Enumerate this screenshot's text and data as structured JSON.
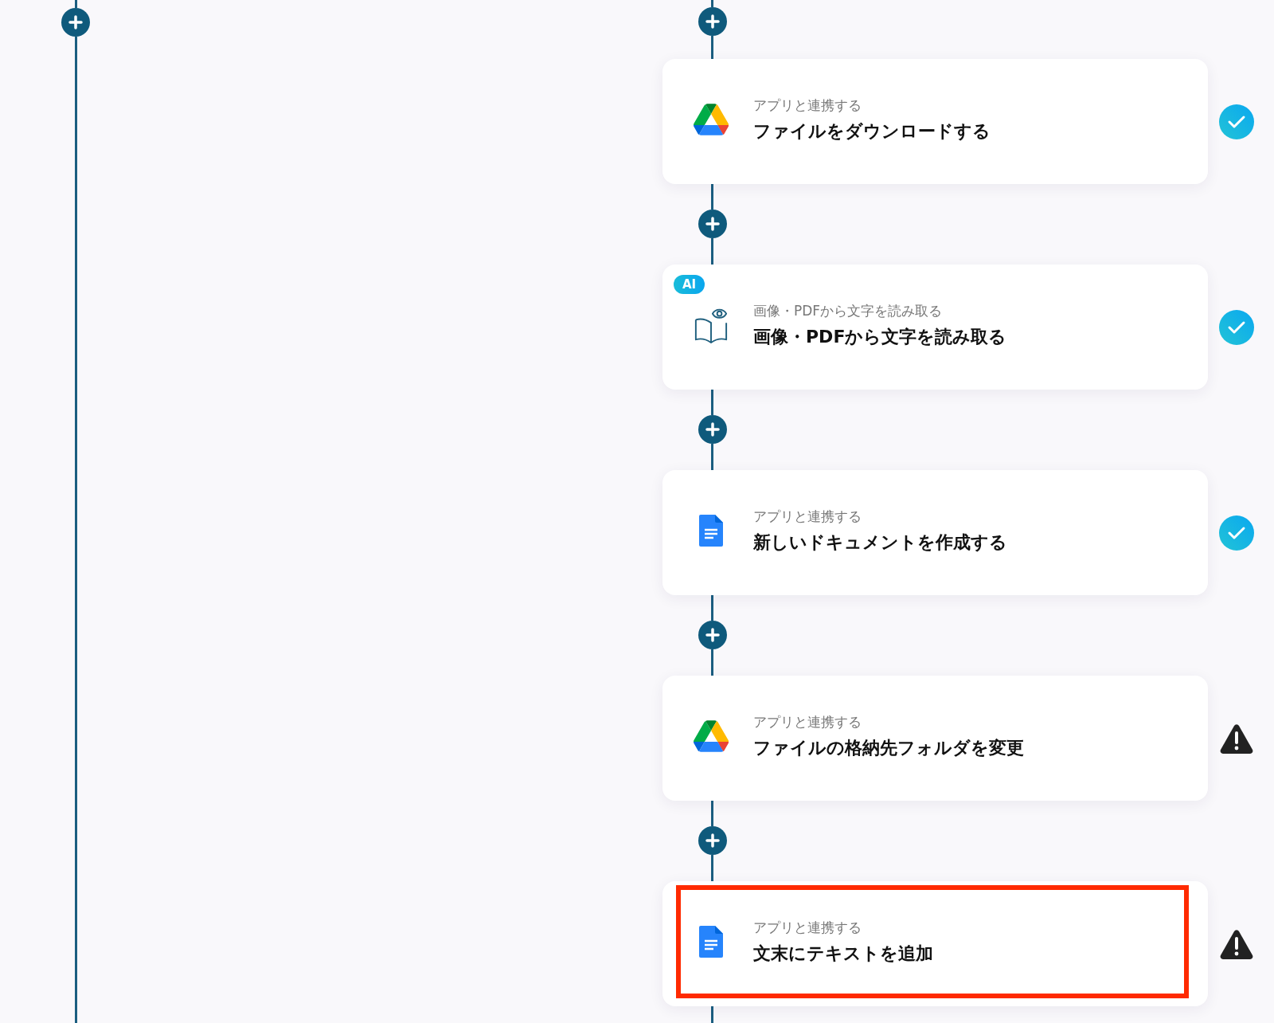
{
  "steps": [
    {
      "kind": "drive",
      "subtitle": "アプリと連携する",
      "title": "ファイルをダウンロードする",
      "completed": true,
      "highlighted": false
    },
    {
      "kind": "ocr",
      "ai_badge": "AI",
      "subtitle": "画像・PDFから文字を読み取る",
      "title": "画像・PDFから文字を読み取る",
      "completed": true,
      "highlighted": false
    },
    {
      "kind": "docs",
      "subtitle": "アプリと連携する",
      "title": "新しいドキュメントを作成する",
      "completed": true,
      "highlighted": false
    },
    {
      "kind": "drive",
      "subtitle": "アプリと連携する",
      "title": "ファイルの格納先フォルダを変更",
      "completed": false,
      "highlighted": false
    },
    {
      "kind": "docs",
      "subtitle": "アプリと連携する",
      "title": "文末にテキストを追加",
      "completed": false,
      "highlighted": true
    }
  ]
}
